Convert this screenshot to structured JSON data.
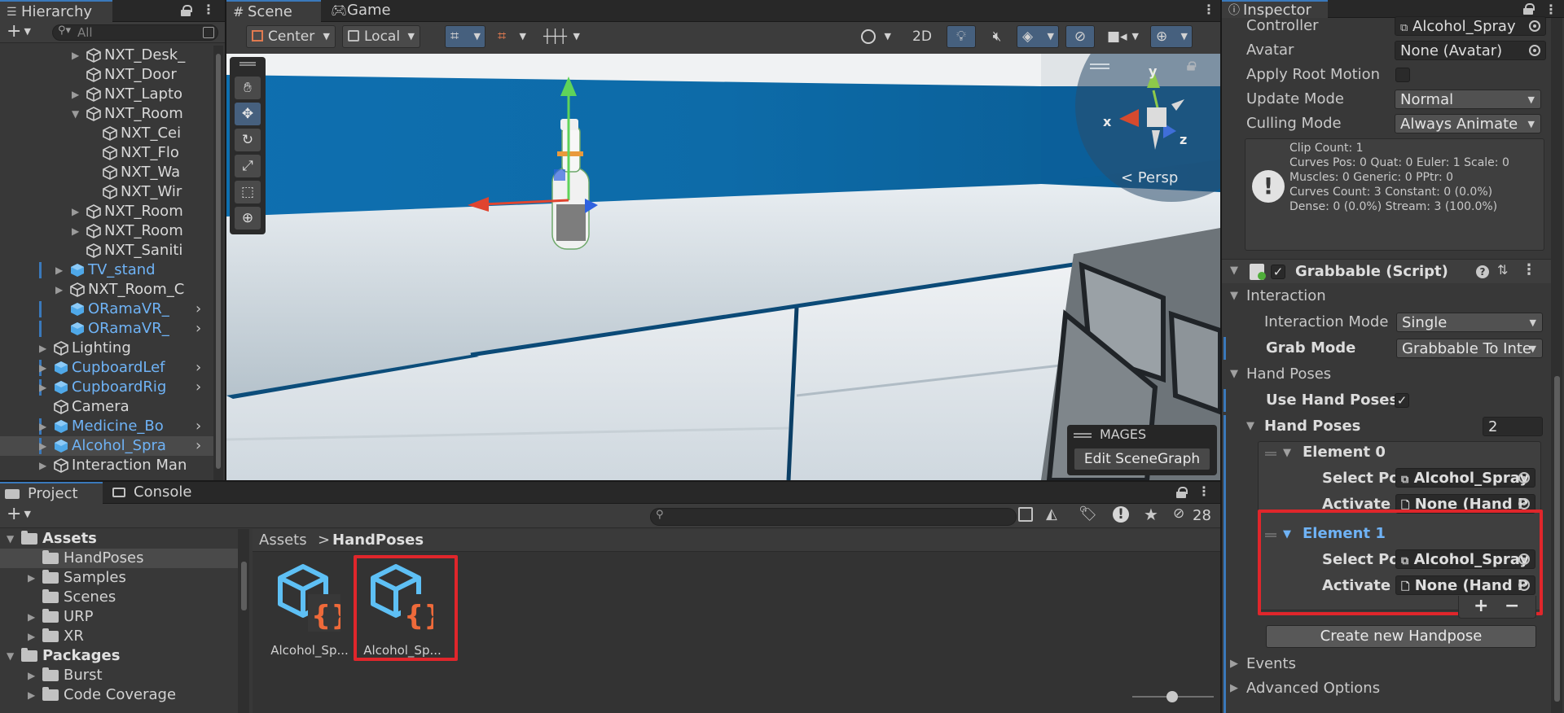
{
  "hierarchy": {
    "title": "Hierarchy",
    "search_placeholder": "All",
    "add_label": "+",
    "items": [
      {
        "label": "NXT_Desk_",
        "indent": 4,
        "arrow": "▶"
      },
      {
        "label": "NXT_Door",
        "indent": 4,
        "arrow": ""
      },
      {
        "label": "NXT_Lapto",
        "indent": 4,
        "arrow": "▶"
      },
      {
        "label": "NXT_Room",
        "indent": 4,
        "arrow": "▼"
      },
      {
        "label": "NXT_Cei",
        "indent": 5,
        "arrow": ""
      },
      {
        "label": "NXT_Flo",
        "indent": 5,
        "arrow": ""
      },
      {
        "label": "NXT_Wa",
        "indent": 5,
        "arrow": ""
      },
      {
        "label": "NXT_Wir",
        "indent": 5,
        "arrow": ""
      },
      {
        "label": "NXT_Room",
        "indent": 4,
        "arrow": "▶"
      },
      {
        "label": "NXT_Room",
        "indent": 4,
        "arrow": "▶"
      },
      {
        "label": "NXT_Saniti",
        "indent": 4,
        "arrow": ""
      },
      {
        "label": "TV_stand",
        "indent": 3,
        "arrow": "▶",
        "prefab": true
      },
      {
        "label": "NXT_Room_C",
        "indent": 3,
        "arrow": "▶"
      },
      {
        "label": "ORamaVR_",
        "indent": 3,
        "arrow": "",
        "prefab": true,
        "chev": true
      },
      {
        "label": "ORamaVR_",
        "indent": 3,
        "arrow": "",
        "prefab": true,
        "chev": true
      },
      {
        "label": "Lighting",
        "indent": 2,
        "arrow": "▶",
        "folder": true
      },
      {
        "label": "CupboardLef",
        "indent": 2,
        "arrow": "▶",
        "prefab": true,
        "chev": true
      },
      {
        "label": "CupboardRig",
        "indent": 2,
        "arrow": "▶",
        "prefab": true,
        "chev": true
      },
      {
        "label": "Camera",
        "indent": 2,
        "arrow": ""
      },
      {
        "label": "Medicine_Bo",
        "indent": 2,
        "arrow": "▶",
        "prefab": true,
        "chev": true
      },
      {
        "label": "Alcohol_Spra",
        "indent": 2,
        "arrow": "▶",
        "prefab": true,
        "chev": true,
        "selected": true
      },
      {
        "label": "Interaction Man",
        "indent": 2,
        "arrow": "▶"
      }
    ]
  },
  "scene": {
    "tab_scene": "Scene",
    "tab_game": "Game",
    "pivot_label": "Center",
    "space_label": "Local",
    "mode_2d": "2D",
    "persp_label": "< Persp",
    "axis_x": "x",
    "axis_y": "y",
    "axis_z": "z",
    "mages_title": "MAGES",
    "edit_scenegraph": "Edit SceneGraph"
  },
  "inspector": {
    "title": "Inspector",
    "animator": {
      "controller_label": "Controller",
      "controller_value": "Alcohol_Spray",
      "avatar_label": "Avatar",
      "avatar_value": "None (Avatar)",
      "root_motion_label": "Apply Root Motion",
      "update_mode_label": "Update Mode",
      "update_mode_value": "Normal",
      "culling_mode_label": "Culling Mode",
      "culling_mode_value": "Always Animate",
      "info_lines": [
        "Clip Count: 1",
        "Curves Pos: 0 Quat: 0 Euler: 1 Scale: 0",
        "Muscles: 0 Generic: 0 PPtr: 0",
        "Curves Count: 3 Constant: 0 (0.0%)",
        "Dense: 0 (0.0%) Stream: 3 (100.0%)"
      ]
    },
    "grabbable": {
      "title": "Grabbable (Script)",
      "interaction_header": "Interaction",
      "interaction_mode_label": "Interaction Mode",
      "interaction_mode_value": "Single",
      "grab_mode_label": "Grab Mode",
      "grab_mode_value": "Grabbable To Inte",
      "hand_poses_header": "Hand Poses",
      "use_hand_poses_label": "Use Hand Poses",
      "hand_poses_list_label": "Hand Poses",
      "hand_poses_count": "2",
      "elements": [
        {
          "title": "Element 0",
          "select_label": "Select Pos",
          "select_value": "Alcohol_Spray",
          "activate_label": "Activate P",
          "activate_value": "None (Hand P"
        },
        {
          "title": "Element 1",
          "select_label": "Select Pos",
          "select_value": "Alcohol_Spray",
          "activate_label": "Activate P",
          "activate_value": "None (Hand P"
        }
      ],
      "plus": "+",
      "minus": "−",
      "create_button": "Create new Handpose",
      "events_header": "Events",
      "advanced_header": "Advanced Options"
    }
  },
  "project": {
    "tab_project": "Project",
    "tab_console": "Console",
    "add_label": "+",
    "hidden_count": "28",
    "breadcrumb_root": "Assets",
    "breadcrumb_sep": ">",
    "breadcrumb_current": "HandPoses",
    "tree": [
      {
        "label": "Assets",
        "indent": 0,
        "arrow": "▼",
        "bold": true
      },
      {
        "label": "HandPoses",
        "indent": 1,
        "arrow": "",
        "selected": true
      },
      {
        "label": "Samples",
        "indent": 1,
        "arrow": "▶"
      },
      {
        "label": "Scenes",
        "indent": 1,
        "arrow": ""
      },
      {
        "label": "URP",
        "indent": 1,
        "arrow": "▶"
      },
      {
        "label": "XR",
        "indent": 1,
        "arrow": "▶"
      },
      {
        "label": "Packages",
        "indent": 0,
        "arrow": "▼",
        "bold": true
      },
      {
        "label": "Burst",
        "indent": 1,
        "arrow": "▶"
      },
      {
        "label": "Code Coverage",
        "indent": 1,
        "arrow": "▶"
      }
    ],
    "assets": [
      {
        "label": "Alcohol_Sp..."
      },
      {
        "label": "Alcohol_Sp..."
      }
    ]
  },
  "colors": {
    "accent": "#3a79bb",
    "highlight_box": "#e0262b",
    "prefab_blue": "#6fb3f6"
  }
}
